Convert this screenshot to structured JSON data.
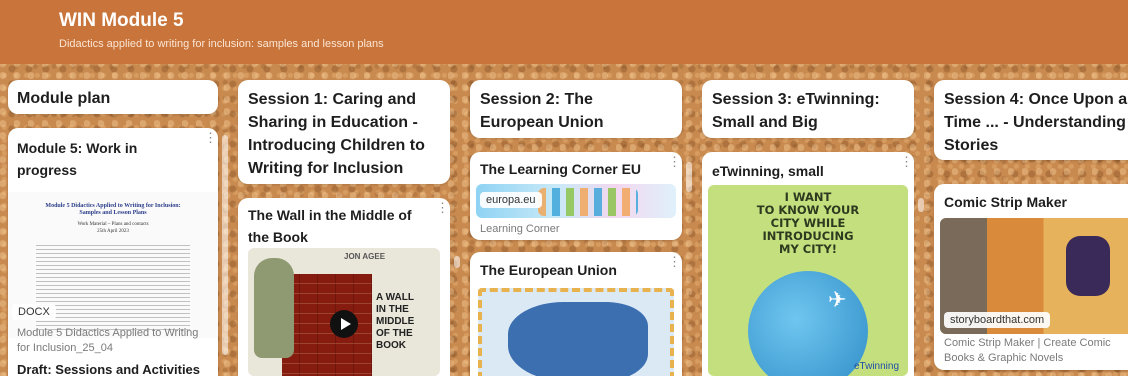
{
  "header": {
    "title": "WIN Module 5",
    "subtitle": "Didactics applied to writing for inclusion: samples and lesson plans"
  },
  "columns": [
    {
      "title": "Module plan",
      "posts": [
        {
          "title": "Module 5: Work in progress",
          "file_type": "DOCX",
          "caption": "Module 5 Didactics Applied to Writing for Inclusion_25_04",
          "doc_heading": "Module 5 Didactics Applied to Writing for Inclusion: Samples and Lesson Plans",
          "doc_sub1": "Work Material – Plans and contacts",
          "doc_sub2": "25th April 2023"
        },
        {
          "title": "Draft: Sessions and Activities"
        }
      ]
    },
    {
      "title": "Session 1: Caring and Sharing in Education - Introducing Children to Writing for Inclusion",
      "posts": [
        {
          "title": "The Wall in the Middle of the Book",
          "book_author": "JON AGEE",
          "book_words": [
            "A WALL",
            "IN THE",
            "MIDDLE",
            "OF THE",
            "BOOK"
          ]
        }
      ]
    },
    {
      "title": "Session 2: The European Union",
      "posts": [
        {
          "title": "The Learning Corner EU",
          "domain": "europa.eu",
          "caption": "Learning Corner"
        },
        {
          "title": "The European Union"
        }
      ]
    },
    {
      "title": "Session 3: eTwinning: Small and Big",
      "posts": [
        {
          "title": "eTwinning, small",
          "image_text": [
            "I WANT",
            "TO KNOW YOUR",
            "CITY WHILE",
            "INTRODUCING",
            "MY CITY!"
          ],
          "brand": "eTwinning"
        }
      ]
    },
    {
      "title": "Session 4: Once Upon a Time ... - Understanding Stories",
      "posts": [
        {
          "title": "Comic Strip Maker",
          "domain": "storyboardthat.com",
          "caption": "Comic Strip Maker | Create Comic Books & Graphic Novels"
        }
      ]
    }
  ],
  "colors": {
    "header": "#c8743a",
    "cork": "#c98a4f",
    "eu_blue": "#1f4fa3"
  }
}
